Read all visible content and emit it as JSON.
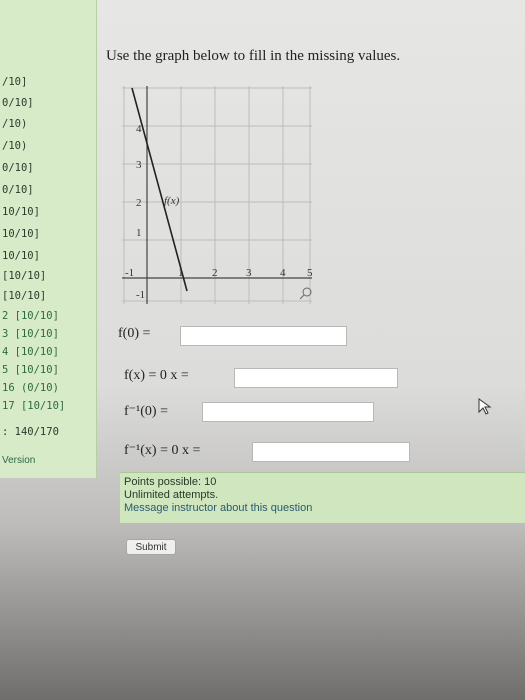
{
  "sidebar": {
    "items": [
      "/10]",
      "0/10]",
      "/10)",
      "/10)",
      "0/10]",
      "0/10]",
      "10/10]",
      "10/10]",
      "10/10]",
      "[10/10]",
      "[10/10]",
      "2 [10/10]",
      "3 [10/10]",
      "4 [10/10]",
      "5 [10/10]",
      "16 (0/10)",
      "17 [10/10]"
    ],
    "total": ": 140/170",
    "version": "Version"
  },
  "question": {
    "title": "Use the graph below to fill in the missing values.",
    "f0_label": "f(0) =",
    "fx_label": "f(x) = 0  x =",
    "finv0_label": "f⁻¹(0) =",
    "finvx_label": "f⁻¹(x) = 0  x ="
  },
  "graph": {
    "curve_label": "f(x)",
    "x_ticks": [
      "-1",
      "1",
      "2",
      "3",
      "4",
      "5"
    ],
    "y_ticks": [
      "4",
      "3",
      "2",
      "1",
      "-1"
    ]
  },
  "info": {
    "points": "Points possible: 10",
    "attempts": "Unlimited attempts.",
    "message": "Message instructor about this question"
  },
  "submit_label": "Submit",
  "colors": {
    "sidebar_bg": "#d7ebc9",
    "info_bg": "#cfe6bf",
    "link": "#2c5b6e"
  }
}
